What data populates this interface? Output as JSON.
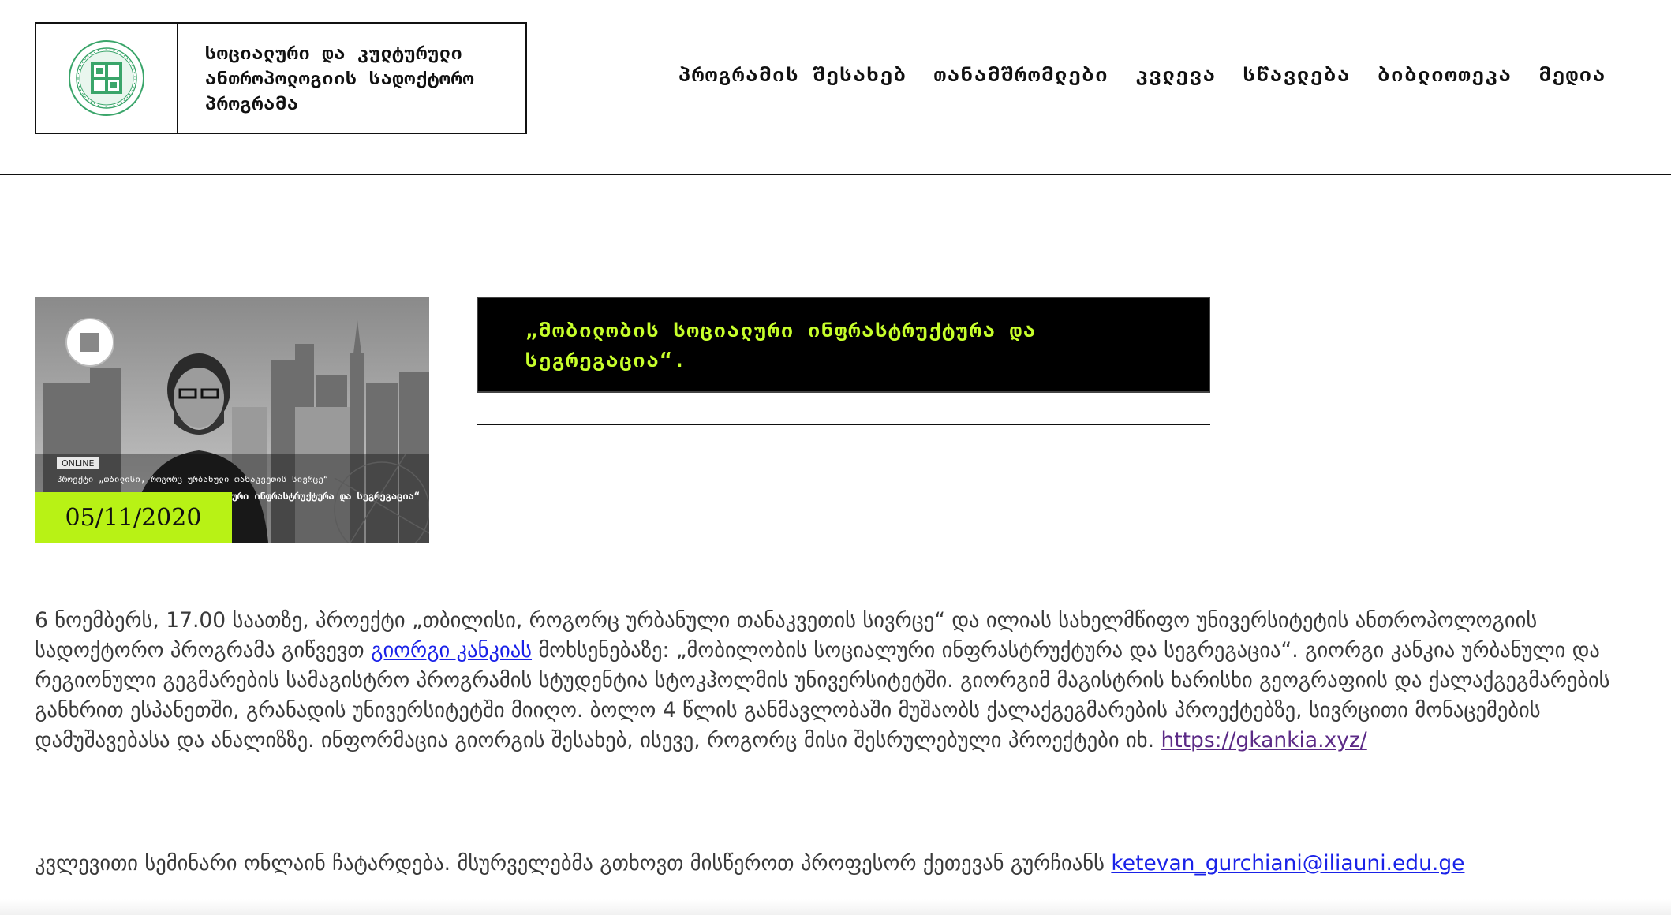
{
  "header": {
    "program_title": "სოციალური და კულტურული ანთროპოლოგიის სადოქტორო პროგრამა",
    "nav": [
      "პროგრამის შესახებ",
      "თანამშრომლები",
      "კვლევა",
      "სწავლება",
      "ბიბლიოთეკა",
      "მედია"
    ]
  },
  "event": {
    "image_badge": "ONLINE",
    "image_caption_line1": "პროექტი „თბილისი, როგორც ურბანული თანაკვეთის სივრცე“",
    "image_caption_line2": "„მობილობის სოციალური ინფრასტრუქტურა და სეგრეგაცია“",
    "date": "05/11/2020",
    "title": "„მობილობის სოციალური ინფრასტრუქტურა და სეგრეგაცია“."
  },
  "body": {
    "p1_before_link": "6 ნოემბერს, 17.00 საათზე, პროექტი „თბილისი, როგორც ურბანული თანაკვეთის სივრცე“ და ილიას სახელმწიფო უნივერსიტეტის ანთროპოლოგიის სადოქტორო პროგრამა გიწვევთ ",
    "speaker_link": "გიორგი კანკიას",
    "p1_after_link": " მოხსენებაზე: „მობილობის სოციალური ინფრასტრუქტურა და სეგრეგაცია“. გიორგი კანკია ურბანული და რეგიონული გეგმარების სამაგისტრო პროგრამის სტუდენტია სტოკჰოლმის უნივერსიტეტში. გიორგიმ მაგისტრის ხარისხი გეოგრაფიის და ქალაქგეგმარების განხრით ესპანეთში, გრანადის უნივერსიტეტში მიიღო. ბოლო 4 წლის განმავლობაში მუშაობს ქალაქგეგმარების პროექტებზე, სივრცითი მონაცემების დამუშავებასა და ანალიზზე. ინფორმაცია გიორგის შესახებ, ისევე, როგორც მისი შესრულებული პროექტები იხ. ",
    "website_link": "https://gkankia.xyz/",
    "p2_text": "კვლევითი სემინარი ონლაინ ჩატარდება. მსურველებმა გთხოვთ მისწეროთ პროფესორ ქეთევან გურჩიანს ",
    "email_link": "ketevan_gurchiani@iliauni.edu.ge"
  },
  "colors": {
    "accent_green": "#b8f215",
    "title_text": "#c7ff2b",
    "link_blue": "#1a22e8",
    "link_visited": "#5b2a86"
  }
}
